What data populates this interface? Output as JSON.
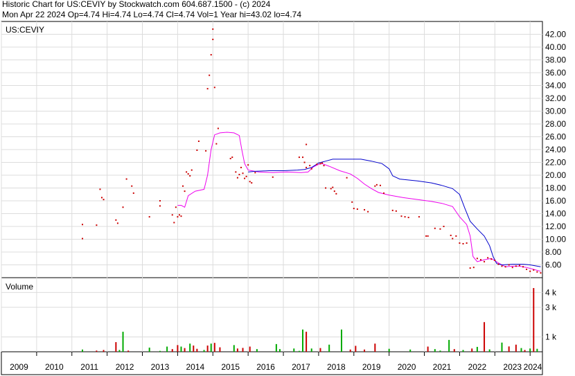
{
  "header": {
    "line1": "Historic Chart for US:CEVIY by Stockwatch.com 604.687.1500 - (c) 2024",
    "line2": "Mon Apr 22 2024  Op=4.74  Hi=4.74  Lo=4.74  Cl=4.74  Vol=1  Year hi=43.02  lo=4.74"
  },
  "chart_data": {
    "type": "scatter",
    "price_panel": {
      "label": "US:CEVIY",
      "ylim": [
        4,
        44
      ],
      "yticks": [
        6,
        8,
        10,
        12,
        14,
        16,
        18,
        20,
        22,
        24,
        26,
        28,
        30,
        32,
        34,
        36,
        38,
        40,
        42
      ],
      "ytick_labels": [
        "6.00",
        "8.00",
        "10.00",
        "12.00",
        "14.00",
        "16.00",
        "18.00",
        "20.00",
        "22.00",
        "24.00",
        "26.00",
        "28.00",
        "30.00",
        "32.00",
        "34.00",
        "36.00",
        "38.00",
        "40.00",
        "42.00"
      ],
      "grid": true,
      "colors": {
        "price": "#cc0000",
        "ma_short": "#ee00ee",
        "ma_long": "#0000cc"
      },
      "price_points": [
        [
          2011.3,
          12.3
        ],
        [
          2011.3,
          10.1
        ],
        [
          2011.7,
          12.2
        ],
        [
          2011.8,
          17.8
        ],
        [
          2011.85,
          16.5
        ],
        [
          2011.9,
          16.2
        ],
        [
          2012.25,
          13.0
        ],
        [
          2012.3,
          12.5
        ],
        [
          2012.45,
          15.0
        ],
        [
          2012.55,
          19.4
        ],
        [
          2012.7,
          18.3
        ],
        [
          2012.75,
          17.2
        ],
        [
          2013.2,
          13.5
        ],
        [
          2013.5,
          16.0
        ],
        [
          2013.5,
          15.2
        ],
        [
          2013.85,
          13.8
        ],
        [
          2013.9,
          12.6
        ],
        [
          2013.95,
          15.0
        ],
        [
          2014.0,
          13.5
        ],
        [
          2014.05,
          13.8
        ],
        [
          2014.1,
          13.6
        ],
        [
          2014.15,
          18.3
        ],
        [
          2014.2,
          17.5
        ],
        [
          2014.25,
          20.5
        ],
        [
          2014.3,
          20.2
        ],
        [
          2014.35,
          19.9
        ],
        [
          2014.4,
          20.8
        ],
        [
          2014.55,
          23.9
        ],
        [
          2014.6,
          25.3
        ],
        [
          2014.8,
          23.8
        ],
        [
          2014.85,
          33.5
        ],
        [
          2014.9,
          35.6
        ],
        [
          2014.95,
          38.8
        ],
        [
          2015.0,
          42.8
        ],
        [
          2015.0,
          41.2
        ],
        [
          2015.05,
          33.7
        ],
        [
          2015.1,
          24.9
        ],
        [
          2015.15,
          27.3
        ],
        [
          2015.5,
          22.6
        ],
        [
          2015.55,
          22.8
        ],
        [
          2015.65,
          20.5
        ],
        [
          2015.7,
          19.6
        ],
        [
          2015.75,
          20.1
        ],
        [
          2015.8,
          21.2
        ],
        [
          2015.85,
          20.3
        ],
        [
          2015.9,
          19.5
        ],
        [
          2015.95,
          19.8
        ],
        [
          2016.0,
          21.6
        ],
        [
          2016.05,
          19.0
        ],
        [
          2016.1,
          18.8
        ],
        [
          2016.2,
          20.4
        ],
        [
          2016.7,
          19.7
        ],
        [
          2017.45,
          22.8
        ],
        [
          2017.55,
          22.8
        ],
        [
          2017.6,
          22.0
        ],
        [
          2017.65,
          21.2
        ],
        [
          2017.75,
          21.5
        ],
        [
          2017.8,
          21.0
        ],
        [
          2017.65,
          24.8
        ],
        [
          2017.95,
          21.7
        ],
        [
          2018.05,
          21.8
        ],
        [
          2018.1,
          21.9
        ],
        [
          2018.15,
          21.5
        ],
        [
          2018.2,
          18.0
        ],
        [
          2018.35,
          17.9
        ],
        [
          2018.4,
          18.1
        ],
        [
          2018.45,
          17.5
        ],
        [
          2018.5,
          17.1
        ],
        [
          2018.8,
          19.6
        ],
        [
          2018.95,
          15.8
        ],
        [
          2019.0,
          14.8
        ],
        [
          2019.1,
          14.7
        ],
        [
          2019.3,
          14.6
        ],
        [
          2019.4,
          14.3
        ],
        [
          2019.6,
          18.3
        ],
        [
          2019.65,
          18.5
        ],
        [
          2019.75,
          18.4
        ],
        [
          2019.85,
          17.2
        ],
        [
          2020.1,
          14.5
        ],
        [
          2020.2,
          14.4
        ],
        [
          2020.35,
          13.6
        ],
        [
          2020.45,
          13.5
        ],
        [
          2020.55,
          13.4
        ],
        [
          2020.85,
          13.5
        ],
        [
          2021.05,
          10.5
        ],
        [
          2021.1,
          10.5
        ],
        [
          2021.3,
          11.7
        ],
        [
          2021.45,
          11.6
        ],
        [
          2021.55,
          12.0
        ],
        [
          2021.75,
          10.6
        ],
        [
          2021.8,
          10.1
        ],
        [
          2021.9,
          10.5
        ],
        [
          2022.0,
          9.4
        ],
        [
          2022.1,
          9.3
        ],
        [
          2022.2,
          9.4
        ],
        [
          2022.3,
          5.5
        ],
        [
          2022.4,
          5.6
        ],
        [
          2022.5,
          7.0
        ],
        [
          2022.6,
          6.8
        ],
        [
          2022.7,
          6.5
        ],
        [
          2022.8,
          7.1
        ],
        [
          2022.9,
          6.9
        ],
        [
          2023.0,
          6.7
        ],
        [
          2023.1,
          6.1
        ],
        [
          2023.2,
          5.8
        ],
        [
          2023.3,
          5.7
        ],
        [
          2023.4,
          6.0
        ],
        [
          2023.5,
          5.6
        ],
        [
          2023.6,
          5.8
        ],
        [
          2023.7,
          5.9
        ],
        [
          2023.8,
          5.7
        ],
        [
          2023.9,
          5.3
        ],
        [
          2024.0,
          5.0
        ],
        [
          2024.1,
          5.2
        ],
        [
          2024.2,
          4.9
        ],
        [
          2024.3,
          4.74
        ]
      ],
      "ma_short": [
        [
          2014.0,
          15.3
        ],
        [
          2014.1,
          15.3
        ],
        [
          2014.2,
          15.0
        ],
        [
          2014.3,
          16.8
        ],
        [
          2014.5,
          17.5
        ],
        [
          2014.75,
          17.8
        ],
        [
          2014.85,
          20.0
        ],
        [
          2014.95,
          24.0
        ],
        [
          2015.05,
          26.3
        ],
        [
          2015.2,
          26.6
        ],
        [
          2015.4,
          26.7
        ],
        [
          2015.6,
          26.6
        ],
        [
          2015.75,
          26.2
        ],
        [
          2015.82,
          24.0
        ],
        [
          2015.9,
          21.8
        ],
        [
          2016.0,
          20.8
        ],
        [
          2016.3,
          20.5
        ],
        [
          2016.7,
          20.4
        ],
        [
          2017.1,
          20.5
        ],
        [
          2017.5,
          20.4
        ],
        [
          2017.7,
          20.5
        ],
        [
          2017.85,
          21.3
        ],
        [
          2018.0,
          21.7
        ],
        [
          2018.1,
          21.8
        ],
        [
          2018.3,
          21.4
        ],
        [
          2018.6,
          20.7
        ],
        [
          2018.9,
          20.2
        ],
        [
          2019.1,
          19.5
        ],
        [
          2019.3,
          18.6
        ],
        [
          2019.5,
          17.9
        ],
        [
          2019.7,
          17.3
        ],
        [
          2020.0,
          16.9
        ],
        [
          2020.4,
          16.5
        ],
        [
          2020.8,
          16.2
        ],
        [
          2021.2,
          15.9
        ],
        [
          2021.5,
          15.6
        ],
        [
          2021.8,
          15.1
        ],
        [
          2022.0,
          13.5
        ],
        [
          2022.2,
          12.3
        ],
        [
          2022.3,
          10.5
        ],
        [
          2022.38,
          7.3
        ],
        [
          2022.5,
          6.5
        ],
        [
          2022.7,
          6.8
        ],
        [
          2022.9,
          7.0
        ],
        [
          2023.1,
          6.3
        ],
        [
          2023.3,
          5.7
        ],
        [
          2023.5,
          5.8
        ],
        [
          2023.7,
          5.8
        ],
        [
          2023.9,
          5.6
        ],
        [
          2024.1,
          5.3
        ],
        [
          2024.3,
          5.0
        ]
      ],
      "ma_long": [
        [
          2016.0,
          20.5
        ],
        [
          2016.2,
          20.6
        ],
        [
          2016.6,
          20.7
        ],
        [
          2017.0,
          20.7
        ],
        [
          2017.4,
          20.8
        ],
        [
          2017.6,
          20.9
        ],
        [
          2017.8,
          21.2
        ],
        [
          2018.0,
          21.9
        ],
        [
          2018.2,
          22.2
        ],
        [
          2018.4,
          22.5
        ],
        [
          2018.8,
          22.5
        ],
        [
          2019.2,
          22.5
        ],
        [
          2019.5,
          22.2
        ],
        [
          2019.8,
          21.8
        ],
        [
          2020.0,
          21.0
        ],
        [
          2020.1,
          19.9
        ],
        [
          2020.3,
          19.4
        ],
        [
          2020.8,
          19.1
        ],
        [
          2021.2,
          18.8
        ],
        [
          2021.5,
          18.4
        ],
        [
          2021.8,
          17.9
        ],
        [
          2022.0,
          17.0
        ],
        [
          2022.15,
          14.8
        ],
        [
          2022.3,
          12.8
        ],
        [
          2022.5,
          11.6
        ],
        [
          2022.7,
          10.5
        ],
        [
          2022.85,
          9.0
        ],
        [
          2022.95,
          7.3
        ],
        [
          2023.05,
          6.2
        ],
        [
          2023.2,
          6.0
        ],
        [
          2023.5,
          6.1
        ],
        [
          2023.8,
          6.1
        ],
        [
          2024.0,
          6.0
        ],
        [
          2024.3,
          5.7
        ]
      ]
    },
    "volume_panel": {
      "label": "Volume",
      "ylim": [
        0,
        5000
      ],
      "yticks": [
        1000,
        3000,
        4000
      ],
      "ytick_labels": [
        "1 k",
        "3 k",
        "4 k"
      ],
      "grid": true,
      "colors": {
        "up": "#00aa00",
        "down": "#cc0000"
      },
      "bars": [
        [
          2011.3,
          150,
          "up"
        ],
        [
          2011.7,
          80,
          "down"
        ],
        [
          2011.9,
          120,
          "down"
        ],
        [
          2012.25,
          650,
          "down"
        ],
        [
          2012.35,
          120,
          "up"
        ],
        [
          2012.45,
          1350,
          "up"
        ],
        [
          2012.6,
          80,
          "down"
        ],
        [
          2013.2,
          280,
          "up"
        ],
        [
          2013.5,
          60,
          "up"
        ],
        [
          2013.7,
          350,
          "up"
        ],
        [
          2013.85,
          180,
          "down"
        ],
        [
          2014.0,
          450,
          "down"
        ],
        [
          2014.1,
          350,
          "up"
        ],
        [
          2014.2,
          250,
          "down"
        ],
        [
          2014.35,
          550,
          "up"
        ],
        [
          2014.45,
          420,
          "down"
        ],
        [
          2014.55,
          200,
          "down"
        ],
        [
          2014.75,
          120,
          "up"
        ],
        [
          2014.85,
          420,
          "down"
        ],
        [
          2014.95,
          550,
          "up"
        ],
        [
          2015.05,
          600,
          "down"
        ],
        [
          2015.2,
          300,
          "down"
        ],
        [
          2015.6,
          450,
          "up"
        ],
        [
          2015.7,
          220,
          "down"
        ],
        [
          2015.85,
          260,
          "down"
        ],
        [
          2016.05,
          350,
          "down"
        ],
        [
          2016.25,
          180,
          "up"
        ],
        [
          2016.8,
          520,
          "up"
        ],
        [
          2016.9,
          180,
          "up"
        ],
        [
          2017.3,
          220,
          "up"
        ],
        [
          2017.45,
          60,
          "up"
        ],
        [
          2017.55,
          1500,
          "up"
        ],
        [
          2017.65,
          1350,
          "down"
        ],
        [
          2017.8,
          220,
          "up"
        ],
        [
          2018.05,
          250,
          "down"
        ],
        [
          2018.3,
          480,
          "up"
        ],
        [
          2018.65,
          1500,
          "up"
        ],
        [
          2018.9,
          150,
          "down"
        ],
        [
          2019.05,
          400,
          "down"
        ],
        [
          2019.3,
          150,
          "down"
        ],
        [
          2019.6,
          550,
          "down"
        ],
        [
          2020.0,
          200,
          "up"
        ],
        [
          2020.6,
          150,
          "up"
        ],
        [
          2021.1,
          350,
          "down"
        ],
        [
          2021.3,
          180,
          "up"
        ],
        [
          2021.45,
          80,
          "up"
        ],
        [
          2021.7,
          800,
          "up"
        ],
        [
          2021.85,
          180,
          "down"
        ],
        [
          2022.1,
          120,
          "up"
        ],
        [
          2022.35,
          220,
          "down"
        ],
        [
          2022.5,
          330,
          "up"
        ],
        [
          2022.7,
          2000,
          "down"
        ],
        [
          2022.85,
          160,
          "up"
        ],
        [
          2023.2,
          620,
          "up"
        ],
        [
          2023.4,
          360,
          "down"
        ],
        [
          2023.6,
          480,
          "down"
        ],
        [
          2023.75,
          250,
          "up"
        ],
        [
          2023.85,
          120,
          "down"
        ],
        [
          2024.0,
          220,
          "up"
        ],
        [
          2024.1,
          4300,
          "down"
        ],
        [
          2024.2,
          200,
          "up"
        ]
      ]
    },
    "x_axis": {
      "xlim": [
        2009,
        2024.35
      ],
      "tick_labels": [
        "2009",
        "2010",
        "2011",
        "2012",
        "2013",
        "2014",
        "2015",
        "2016",
        "2017",
        "2018",
        "2019",
        "2020",
        "2021",
        "2022",
        "2023",
        "2024"
      ],
      "tick_years": [
        2009,
        2010,
        2011,
        2012,
        2013,
        2014,
        2015,
        2016,
        2017,
        2018,
        2019,
        2020,
        2021,
        2022,
        2023,
        2024
      ]
    }
  }
}
